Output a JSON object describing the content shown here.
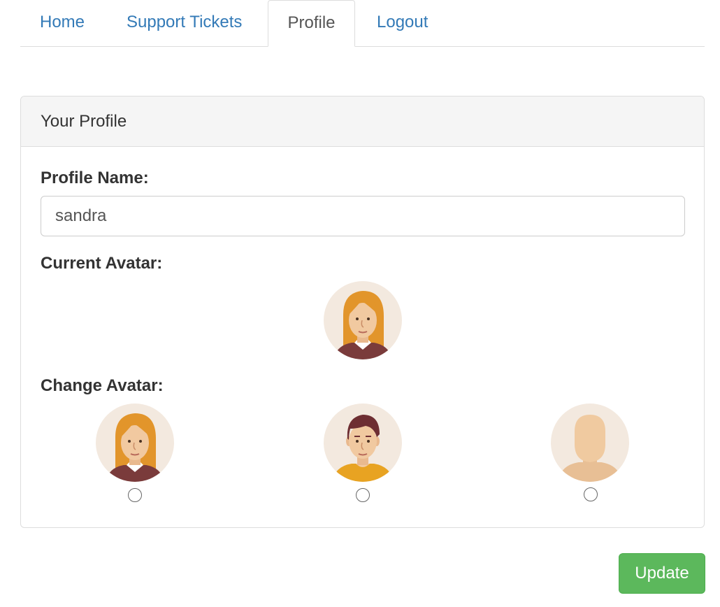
{
  "nav": {
    "items": [
      {
        "label": "Home",
        "active": false
      },
      {
        "label": "Support Tickets",
        "active": false
      },
      {
        "label": "Profile",
        "active": true
      },
      {
        "label": "Logout",
        "active": false
      }
    ]
  },
  "panel": {
    "heading": "Your Profile",
    "profile_name_label": "Profile Name:",
    "profile_name_value": "sandra",
    "current_avatar_label": "Current Avatar:",
    "current_avatar": "female-avatar-icon",
    "change_avatar_label": "Change Avatar:",
    "avatar_options": [
      {
        "icon": "female-avatar-icon",
        "selected": false
      },
      {
        "icon": "male-avatar-icon",
        "selected": false
      },
      {
        "icon": "default-avatar-icon",
        "selected": false
      }
    ]
  },
  "update_button": "Update",
  "colors": {
    "link": "#337ab7",
    "active_tab_text": "#555555",
    "button_green": "#5cb85c",
    "panel_heading_bg": "#f5f5f5",
    "border": "#dddddd"
  }
}
